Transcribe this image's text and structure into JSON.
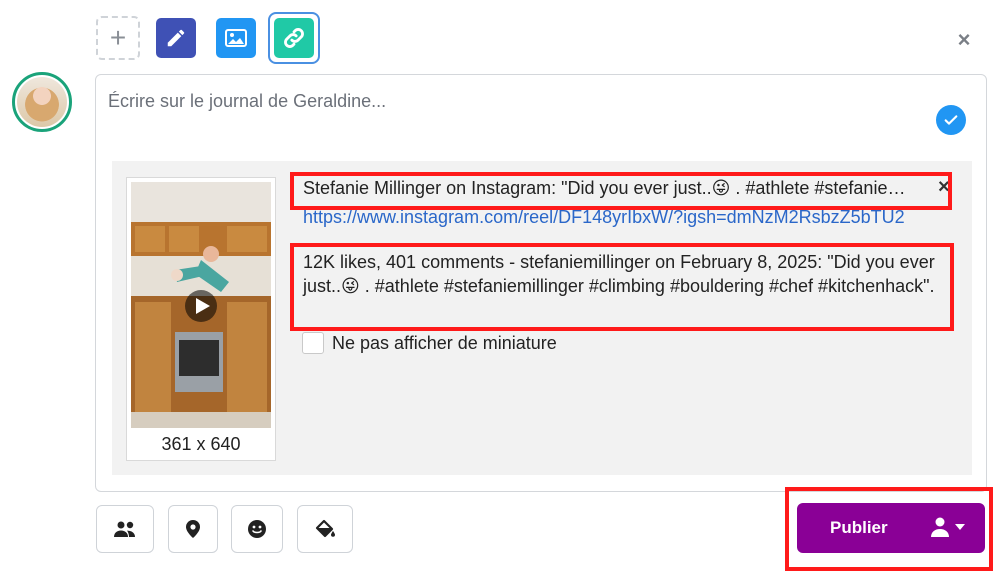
{
  "toolbar": {
    "add_symbol": "+",
    "pen_icon": "pencil-icon",
    "image_icon": "image-icon",
    "link_icon": "link-icon"
  },
  "close_symbol": "×",
  "composer": {
    "placeholder": "Écrire sur le journal de Geraldine..."
  },
  "link_preview": {
    "title": "Stefanie Millinger on Instagram: \"Did you ever just..😜 . #athlete #stefaniemillinger #climbing #bouldering #chef #kitchenhack\"",
    "remove_symbol": "×",
    "url": "https://www.instagram.com/reel/DF148yrIbxW/?igsh=dmNzM2RsbzZ5bTU2",
    "description": "12K likes, 401 comments - stefaniemillinger on February 8, 2025: \"Did you ever just..😜 . #athlete #stefaniemillinger #climbing #bouldering #chef #kitchenhack\".",
    "thumbnail_size": "361 x 640",
    "no_thumbnail_label": "Ne pas afficher de miniature"
  },
  "actions": {
    "publish_label": "Publier"
  },
  "colors": {
    "publish": "#8a0096",
    "highlight": "#ff1a1a",
    "link": "#2a67c9"
  }
}
